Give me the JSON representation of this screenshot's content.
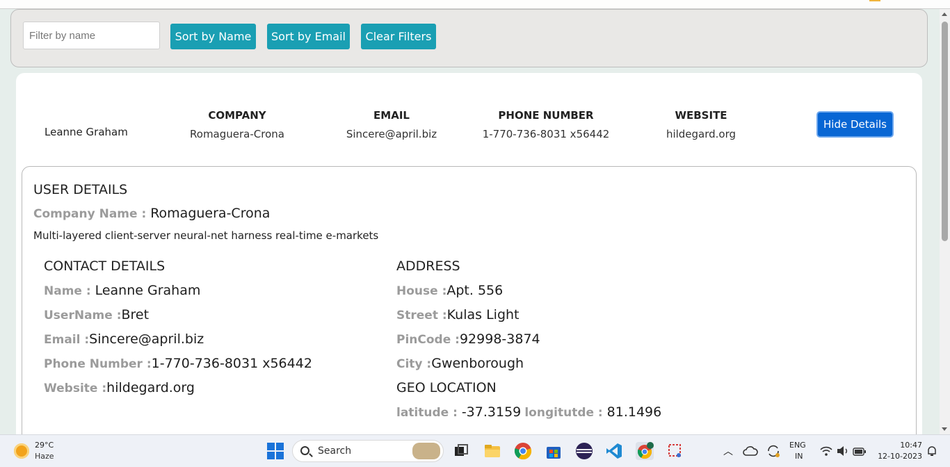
{
  "filters": {
    "search_placeholder": "Filter by name",
    "sort_name_label": "Sort by Name",
    "sort_email_label": "Sort by Email",
    "clear_label": "Clear Filters"
  },
  "user_row": {
    "name": "Leanne Graham",
    "company_header": "COMPANY",
    "company": "Romaguera-Crona",
    "email_header": "EMAIL",
    "email": "Sincere@april.biz",
    "phone_header": "PHONE NUMBER",
    "phone": "1-770-736-8031 x56442",
    "website_header": "WEBSITE",
    "website": "hildegard.org",
    "toggle_label": "Hide Details"
  },
  "details": {
    "title": "USER DETAILS",
    "company_label": "Company Name : ",
    "company_value": "Romaguera-Crona",
    "catch_phrase": "Multi-layered client-server neural-net harness real-time e-markets",
    "contact": {
      "title": "CONTACT DETAILS",
      "name_label": "Name : ",
      "name_value": "Leanne Graham",
      "username_label": "UserName :",
      "username_value": "Bret",
      "email_label": "Email :",
      "email_value": "Sincere@april.biz",
      "phone_label": "Phone Number :",
      "phone_value": "1-770-736-8031 x56442",
      "website_label": "Website :",
      "website_value": "hildegard.org"
    },
    "address": {
      "title": "ADDRESS",
      "house_label": "House :",
      "house_value": "Apt. 556",
      "street_label": "Street :",
      "street_value": "Kulas Light",
      "pincode_label": "PinCode :",
      "pincode_value": "92998-3874",
      "city_label": "City :",
      "city_value": "Gwenborough"
    },
    "geo": {
      "title": "GEO LOCATION",
      "lat_label": "latitude : ",
      "lat_value": "-37.3159",
      "lng_label": "longitutde : ",
      "lng_value": "81.1496"
    }
  },
  "taskbar": {
    "temperature": "29°C",
    "weather": "Haze",
    "search_label": "Search",
    "language_1": "ENG",
    "language_2": "IN",
    "time": "10:47",
    "date": "12-10-2023"
  }
}
